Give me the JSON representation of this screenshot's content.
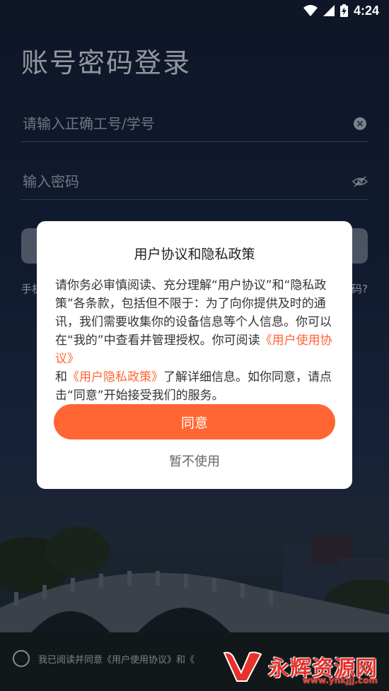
{
  "status_bar": {
    "time": "4:24",
    "icons": [
      "wifi-icon",
      "signal-icon",
      "battery-charging-icon"
    ]
  },
  "login": {
    "title": "账号密码登录",
    "account_placeholder": "请输入正确工号/学号",
    "password_placeholder": "输入密码",
    "hint_left": "手机",
    "hint_right": "码?"
  },
  "footer": {
    "agree_text": "我已阅读并同意《用户使用协议》和《"
  },
  "dialog": {
    "title": "用户协议和隐私政策",
    "body_part1": "请你务必审慎阅读、充分理解“用户协议”和“隐私政策”各条款，包括但不限于：为了向你提供及时的通讯，我们需要收集你的设备信息等个人信息。你可以在“我的”中查看并管理授权。你可阅读",
    "link_user_agreement": "《用户使用协议》",
    "body_and": "和",
    "link_privacy_policy": "《用户隐私政策》",
    "body_part2": "了解详细信息。如你同意，请点击“同意”开始接受我们的服务。",
    "agree_label": "同意",
    "decline_label": "暂不使用"
  },
  "watermark": {
    "brand": "永辉资源网",
    "url": "www.yhkjjj.com"
  },
  "colors": {
    "accent": "#ff6633",
    "watermark": "#e8312b"
  }
}
